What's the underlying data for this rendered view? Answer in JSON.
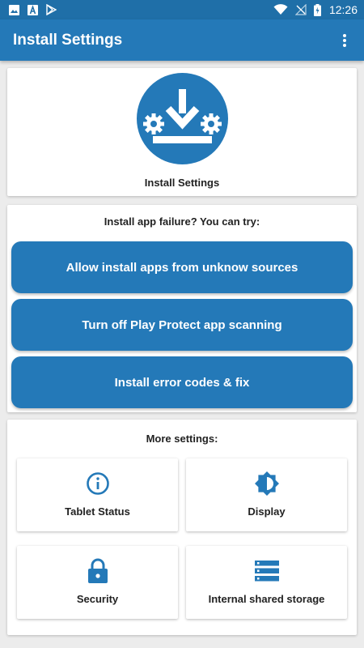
{
  "status_bar": {
    "time": "12:26",
    "icons": [
      "image-icon",
      "font-a-icon",
      "play-store-icon",
      "wifi-icon",
      "no-signal-icon",
      "battery-charging-icon"
    ]
  },
  "app_bar": {
    "title": "Install Settings",
    "menu_icon": "more-vert-icon"
  },
  "hero": {
    "icon": "install-settings-icon",
    "label": "Install Settings"
  },
  "failure_section": {
    "title": "Install app failure? You can try:",
    "buttons": [
      {
        "label": "Allow install apps from unknow sources"
      },
      {
        "label": "Turn off Play Protect app scanning"
      },
      {
        "label": "Install error codes & fix"
      }
    ]
  },
  "more_section": {
    "title": "More settings:",
    "tiles": [
      {
        "label": "Tablet Status",
        "icon": "info-icon"
      },
      {
        "label": "Display",
        "icon": "brightness-icon"
      },
      {
        "label": "Security",
        "icon": "lock-icon"
      },
      {
        "label": "Internal shared storage",
        "icon": "storage-icon"
      }
    ]
  },
  "colors": {
    "primary": "#2479b8",
    "status_bar": "#1f6fa8",
    "icon_blue": "#2479b8"
  }
}
